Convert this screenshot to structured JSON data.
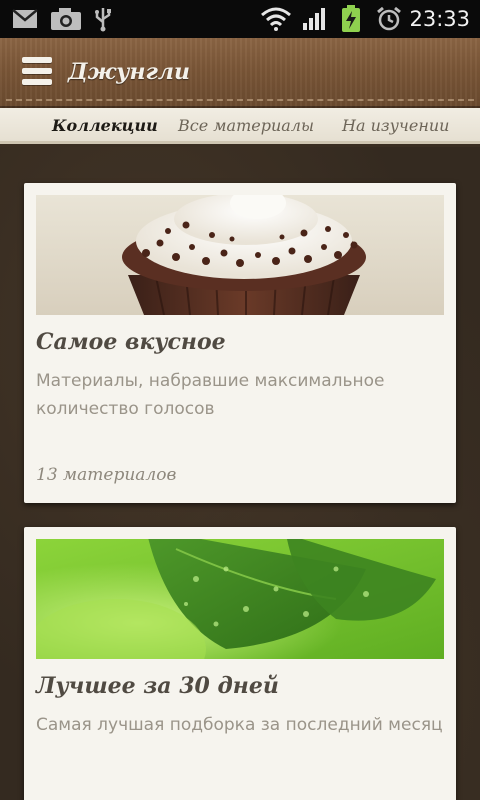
{
  "status_bar": {
    "time": "23:33",
    "icons": [
      "mail-icon",
      "camera-icon",
      "usb-icon",
      "wifi-icon",
      "signal-icon",
      "battery-charging-icon",
      "alarm-icon"
    ]
  },
  "action_bar": {
    "title": "Джунгли",
    "menu_icon": "hamburger-menu-icon"
  },
  "tabs": [
    {
      "label": "Коллекции",
      "active": true
    },
    {
      "label": "Все материалы",
      "active": false
    },
    {
      "label": "На изучении",
      "active": false
    }
  ],
  "collections": [
    {
      "title": "Самое вкусное",
      "description": "Материалы, набравшие максимальное количество голосов",
      "count": "13 материалов",
      "image": "cupcake-image"
    },
    {
      "title": "Лучшее за 30 дней",
      "description": "Самая лучшая подборка за последний месяц",
      "count": "",
      "image": "mint-leaves-image"
    }
  ],
  "colors": {
    "status_bar": "#0a0a0a",
    "action_bar": "#7a5637",
    "tab_bar": "#f1ede3",
    "background": "#342a20",
    "card": "#f6f4ee",
    "title_text": "#504a42",
    "secondary_text": "#9a9489",
    "battery": "#8fd14f"
  }
}
